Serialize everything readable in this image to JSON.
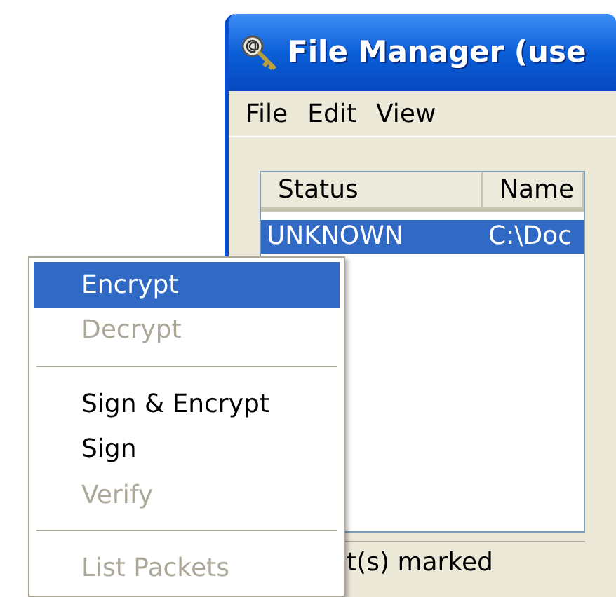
{
  "window": {
    "title": "File Manager (use"
  },
  "menu_bar": [
    "File",
    "Edit",
    "View"
  ],
  "table": {
    "columns": [
      "Status",
      "Name"
    ],
    "rows": [
      {
        "cells": [
          "UNKNOWN",
          "C:\\Doc"
        ],
        "selected": true
      }
    ]
  },
  "status_bar": "t(s) marked",
  "context_menu": [
    {
      "kind": "item",
      "label": "Encrypt",
      "selected": true,
      "disabled": false
    },
    {
      "kind": "item",
      "label": "Decrypt",
      "selected": false,
      "disabled": true
    },
    {
      "kind": "separator"
    },
    {
      "kind": "item",
      "label": "Sign & Encrypt",
      "selected": false,
      "disabled": false
    },
    {
      "kind": "item",
      "label": "Sign",
      "selected": false,
      "disabled": false
    },
    {
      "kind": "item",
      "label": "Verify",
      "selected": false,
      "disabled": true
    },
    {
      "kind": "separator"
    },
    {
      "kind": "item",
      "label": "List Packets",
      "selected": false,
      "disabled": true
    }
  ]
}
